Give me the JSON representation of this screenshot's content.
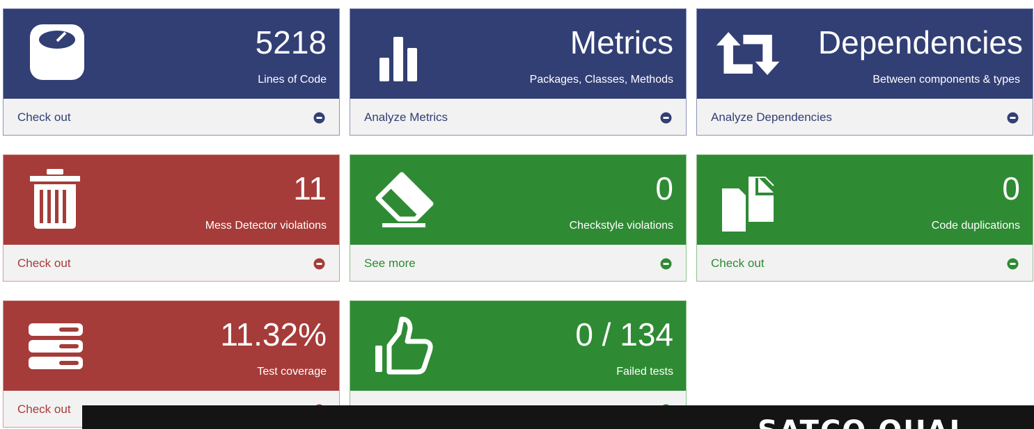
{
  "header": {
    "partial_text": ""
  },
  "panels": [
    {
      "value": "5218",
      "subtitle": "Lines of Code",
      "link": "Check out",
      "color": "#323f74",
      "icon": "scale-icon"
    },
    {
      "value": "Metrics",
      "subtitle": "Packages, Classes, Methods",
      "link": "Analyze Metrics",
      "color": "#323f74",
      "icon": "bar-chart-icon"
    },
    {
      "value": "Dependencies",
      "subtitle": "Between components & types",
      "link": "Analyze Dependencies",
      "color": "#323f74",
      "icon": "retweet-icon"
    },
    {
      "value": "11",
      "subtitle": "Mess Detector violations",
      "link": "Check out",
      "color": "#a53c39",
      "icon": "trash-icon"
    },
    {
      "value": "0",
      "subtitle": "Checkstyle violations",
      "link": "See more",
      "color": "#2f8a34",
      "icon": "eraser-icon"
    },
    {
      "value": "0",
      "subtitle": "Code duplications",
      "link": "Check out",
      "color": "#2f8a34",
      "icon": "copy-icon"
    },
    {
      "value": "11.32%",
      "subtitle": "Test coverage",
      "link": "Check out",
      "color": "#a53c39",
      "icon": "server-icon"
    },
    {
      "value": "0 / 134",
      "subtitle": "Failed tests",
      "link": "",
      "color": "#2f8a34",
      "icon": "thumbs-up-icon"
    }
  ],
  "overlay": {
    "text": "SATCO QUAL"
  }
}
